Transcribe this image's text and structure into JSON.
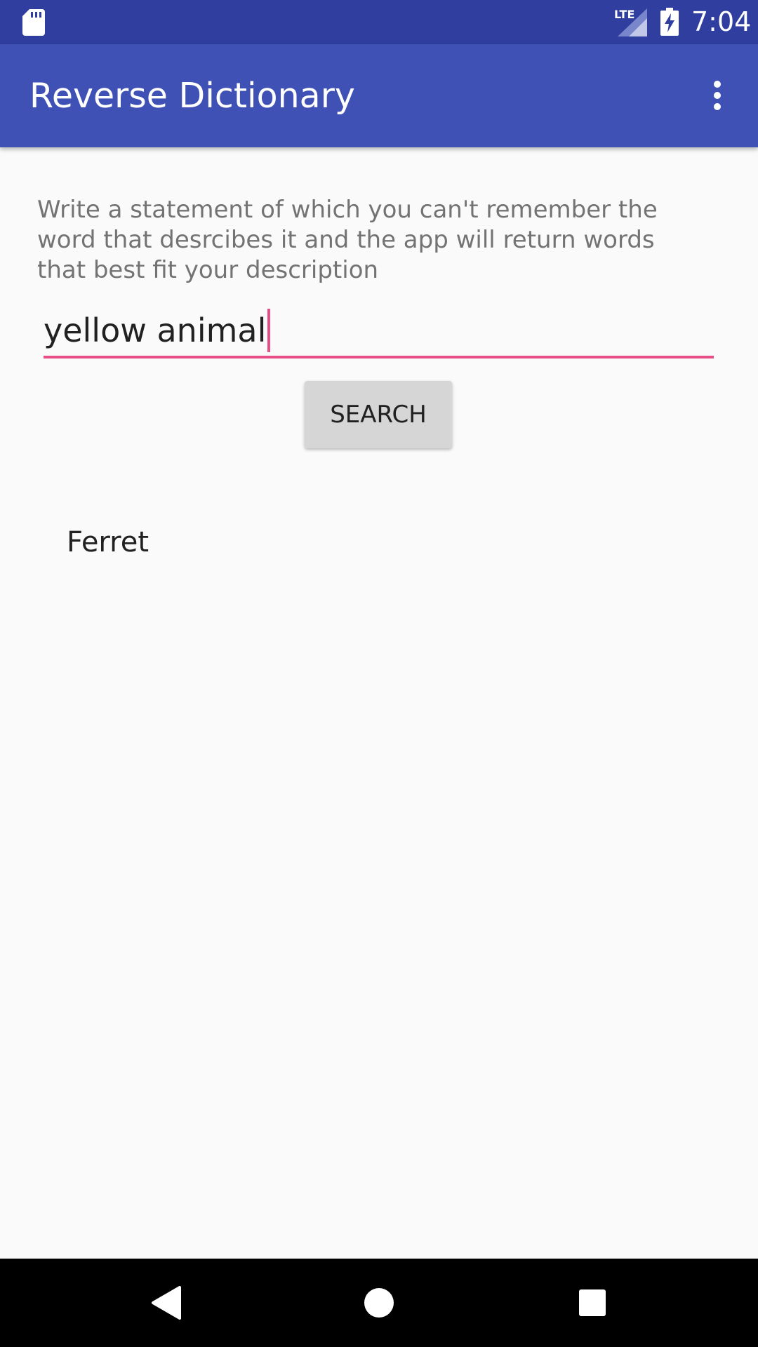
{
  "status_bar": {
    "network_label": "LTE",
    "time": "7:04"
  },
  "app_bar": {
    "title": "Reverse Dictionary"
  },
  "main": {
    "instructions": "Write a statement of which you can't remember the word that desrcibes it and the app will return words that best fit your description",
    "search_value": "yellow animal",
    "search_button_label": "SEARCH",
    "results": [
      "Ferret"
    ]
  },
  "colors": {
    "status_bar": "#303f9f",
    "app_bar": "#3f51b5",
    "accent": "#e84f86",
    "background": "#fafafa"
  },
  "icons": {
    "status": [
      "sd-card-icon",
      "signal-icon",
      "battery-charging-icon"
    ],
    "app_bar": [
      "overflow-menu-icon"
    ],
    "nav": [
      "back-icon",
      "home-icon",
      "recents-icon"
    ]
  }
}
